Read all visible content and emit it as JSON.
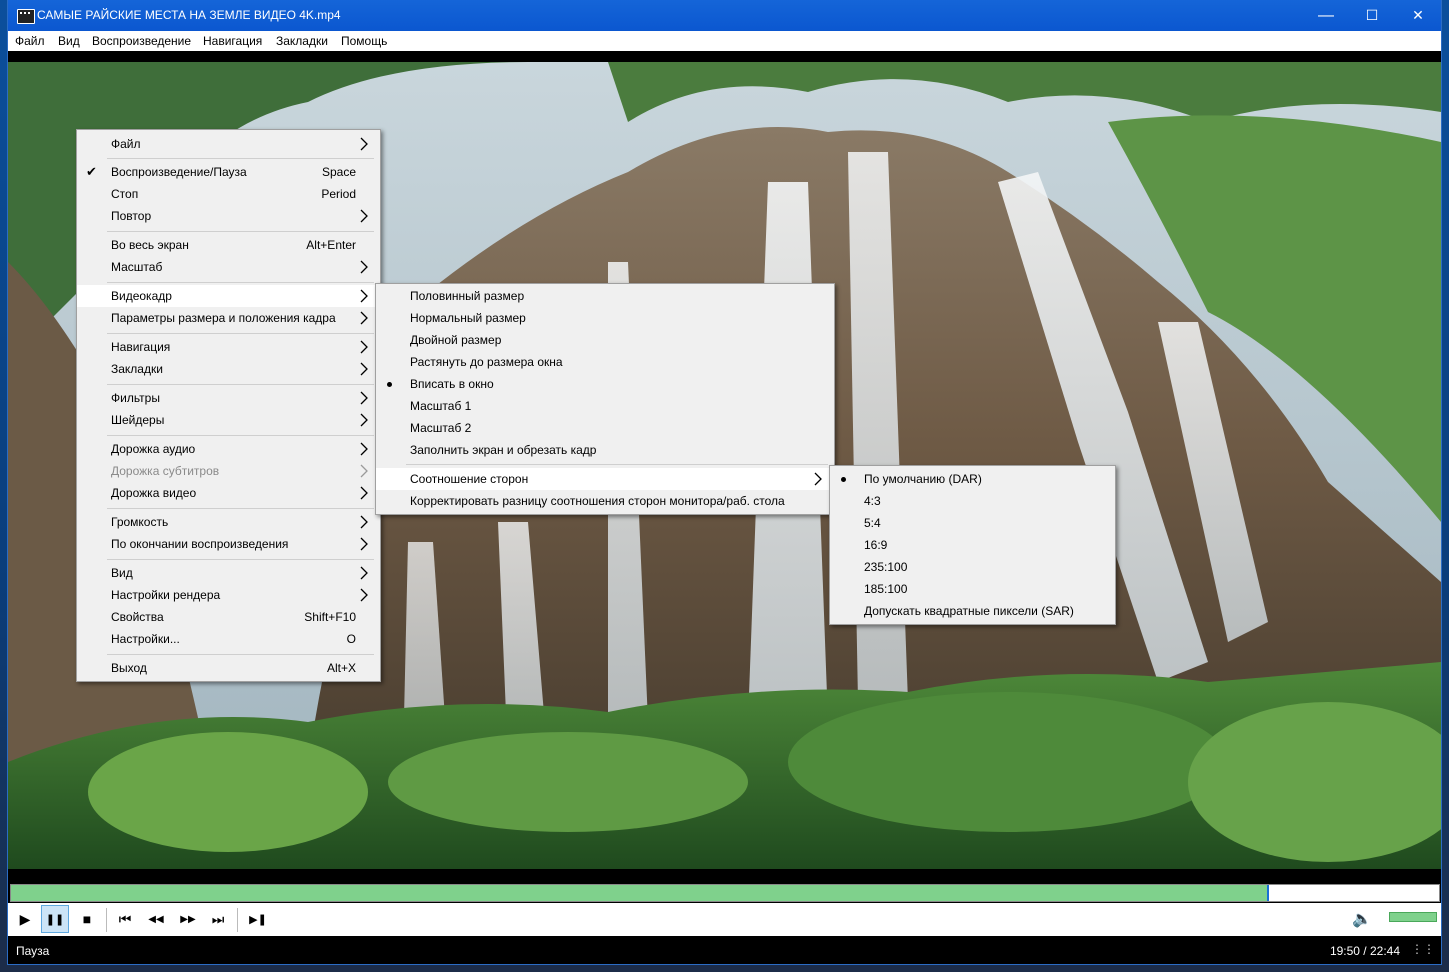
{
  "window": {
    "title": "САМЫЕ РАЙСКИЕ МЕСТА НА ЗЕМЛЕ ВИДЕО 4K.mp4",
    "minimize": "—",
    "maximize": "☐",
    "close": "✕"
  },
  "menubar": {
    "items": [
      "Файл",
      "Вид",
      "Воспроизведение",
      "Навигация",
      "Закладки",
      "Помощь"
    ]
  },
  "context_menu": {
    "items": [
      {
        "label": "Файл",
        "submenu": true
      },
      {
        "label": "Воспроизведение/Пауза",
        "shortcut": "Space",
        "checked": true
      },
      {
        "label": "Стоп",
        "shortcut": "Period"
      },
      {
        "label": "Повтор",
        "submenu": true
      },
      {
        "label": "Во весь экран",
        "shortcut": "Alt+Enter"
      },
      {
        "label": "Масштаб",
        "submenu": true
      },
      {
        "label": "Видеокадр",
        "submenu": true,
        "highlighted": true
      },
      {
        "label": "Параметры размера и положения кадра",
        "submenu": true
      },
      {
        "label": "Навигация",
        "submenu": true
      },
      {
        "label": "Закладки",
        "submenu": true
      },
      {
        "label": "Фильтры",
        "submenu": true
      },
      {
        "label": "Шейдеры",
        "submenu": true
      },
      {
        "label": "Дорожка аудио",
        "submenu": true
      },
      {
        "label": "Дорожка субтитров",
        "submenu": true,
        "disabled": true
      },
      {
        "label": "Дорожка видео",
        "submenu": true
      },
      {
        "label": "Громкость",
        "submenu": true
      },
      {
        "label": "По окончании воспроизведения",
        "submenu": true
      },
      {
        "label": "Вид",
        "submenu": true
      },
      {
        "label": "Настройки рендера",
        "submenu": true
      },
      {
        "label": "Свойства",
        "shortcut": "Shift+F10"
      },
      {
        "label": "Настройки...",
        "shortcut": "O"
      },
      {
        "label": "Выход",
        "shortcut": "Alt+X"
      }
    ]
  },
  "videoframe_menu": {
    "items": [
      {
        "label": "Половинный размер"
      },
      {
        "label": "Нормальный размер"
      },
      {
        "label": "Двойной размер"
      },
      {
        "label": "Растянуть до размера окна"
      },
      {
        "label": "Вписать в окно",
        "selected": true
      },
      {
        "label": "Масштаб 1"
      },
      {
        "label": "Масштаб 2"
      },
      {
        "label": "Заполнить экран и обрезать кадр"
      },
      {
        "label": "Соотношение сторон",
        "submenu": true,
        "highlighted": true
      },
      {
        "label": "Корректировать разницу соотношения сторон монитора/раб. стола"
      }
    ]
  },
  "aspect_menu": {
    "items": [
      {
        "label": "По умолчанию (DAR)",
        "selected": true
      },
      {
        "label": "4:3"
      },
      {
        "label": "5:4"
      },
      {
        "label": "16:9"
      },
      {
        "label": "235:100"
      },
      {
        "label": "185:100"
      },
      {
        "label": "Допускать квадратные пиксели (SAR)"
      }
    ]
  },
  "seek": {
    "progress": 0.8795
  },
  "controls": {
    "play": "▶",
    "pause": "❚❚",
    "stop": "■",
    "prev": "⏮",
    "rewind": "◀◀",
    "forward": "▶▶",
    "next": "⏭",
    "frame_step": "▶❚",
    "volume_icon": "🔈",
    "volume_level": 1.0
  },
  "status": {
    "state": "Пауза",
    "time": "19:50 / 22:44",
    "grip": "⋮⋮"
  },
  "colors": {
    "titlebar": "#0b57d0",
    "progress": "#7fd18c",
    "menu_bg": "#f0f0f0"
  }
}
